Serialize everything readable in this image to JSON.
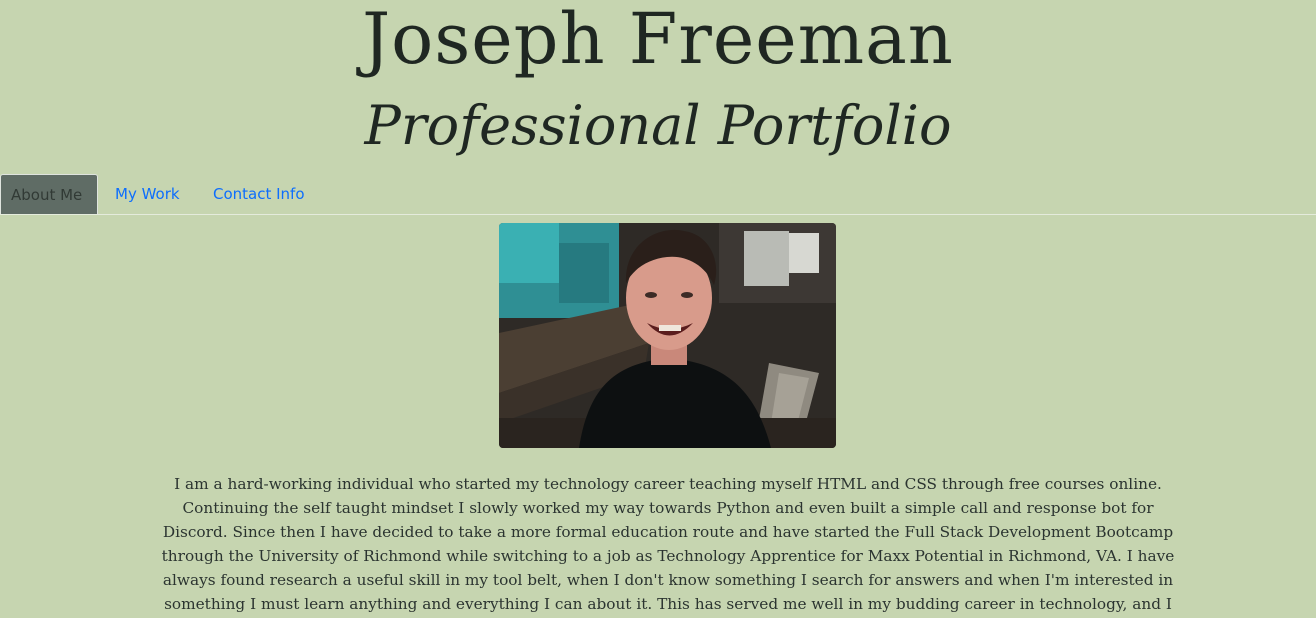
{
  "header": {
    "name": "Joseph Freeman",
    "subtitle": "Professional Portfolio"
  },
  "tabs": [
    {
      "label": "About Me",
      "active": true
    },
    {
      "label": "My Work",
      "active": false
    },
    {
      "label": "Contact Info",
      "active": false
    }
  ],
  "profile_photo": {
    "alt": "profile-photo"
  },
  "bio": {
    "text": "I am a hard-working individual who started my technology career teaching myself HTML and CSS through free courses online. Continuing the self taught mindset I slowly worked my way towards Python and even built a simple call and response bot for Discord. Since then I have decided to take a more formal education route and have started the Full Stack Development Bootcamp through the University of Richmond while switching to a job as Technology Apprentice for Maxx Potential in Richmond, VA. I have always found research a useful skill in my tool belt, when I don't know something I search for answers and when I'm interested in something I must learn anything and everything I can about it. This has served me well in my budding career in technology, and I plan on that passion for"
  },
  "colors": {
    "background": "#c6d5b0",
    "link": "#0d6efd",
    "active_tab": "#5f6c65",
    "heading": "#1f2722"
  }
}
